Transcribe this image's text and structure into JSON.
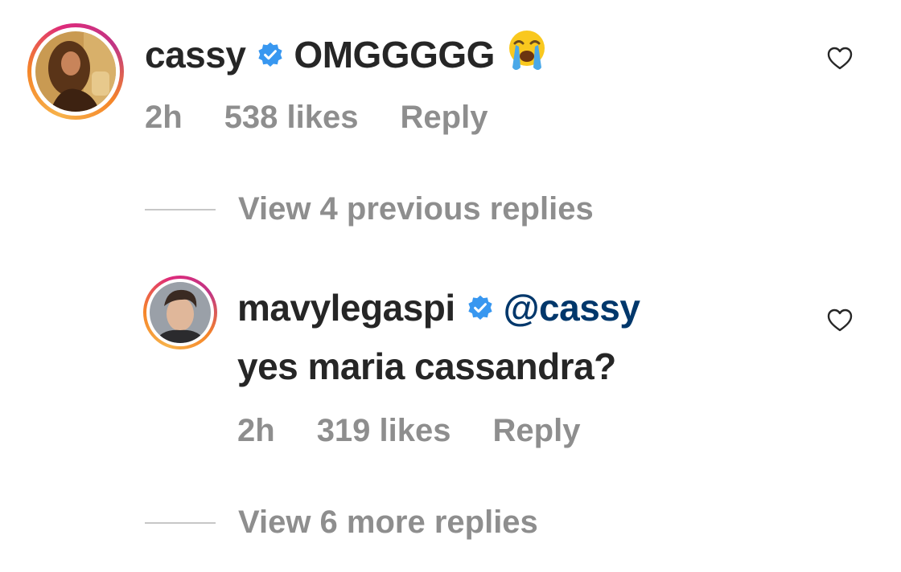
{
  "comment": {
    "username": "cassy",
    "text": "OMGGGGG",
    "emoji": "loudly-crying-face-emoji",
    "time": "2h",
    "likes": "538 likes",
    "reply_label": "Reply",
    "view_previous": "View 4 previous replies"
  },
  "reply": {
    "username": "mavylegaspi",
    "mention": "@cassy",
    "text": "yes maria cassandra?",
    "time": "2h",
    "likes": "319 likes",
    "reply_label": "Reply",
    "view_more": "View 6 more replies"
  },
  "icons": {
    "verified": "verified-badge-icon",
    "like": "heart-icon"
  },
  "colors": {
    "verified_blue": "#3897f0",
    "mention_blue": "#00376b",
    "meta_gray": "#8e8e8e",
    "text_dark": "#262626"
  }
}
